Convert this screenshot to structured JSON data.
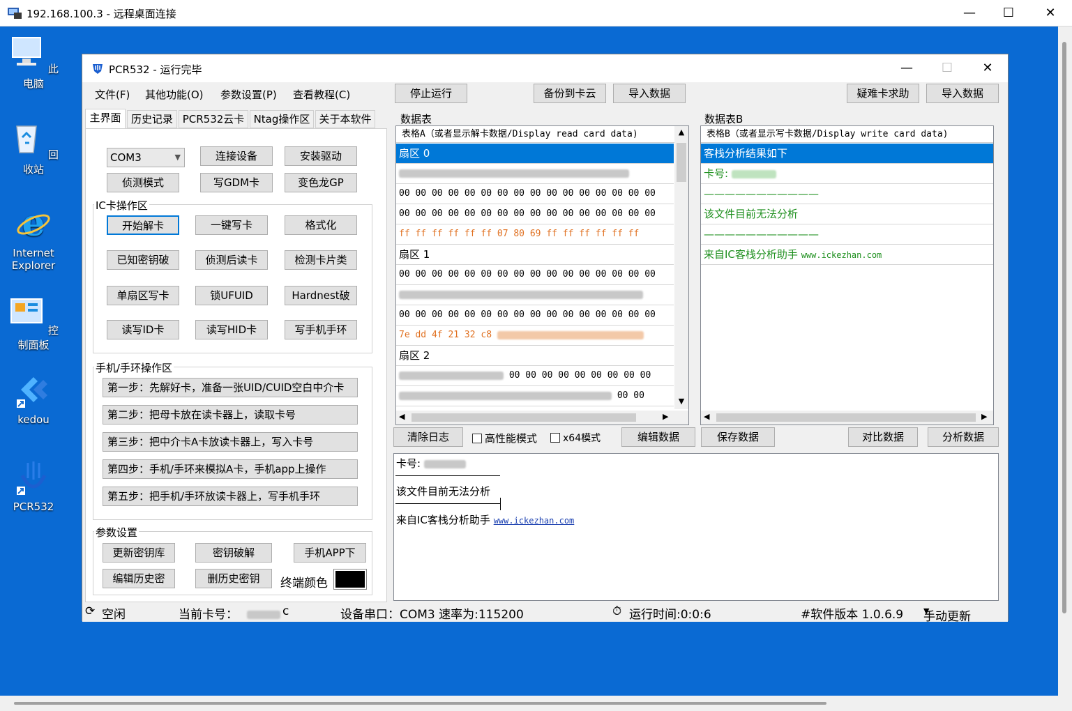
{
  "rdp": {
    "title": "192.168.100.3 - 远程桌面连接",
    "min": "—",
    "max": "☐",
    "close": "✕"
  },
  "desktop_icons": [
    {
      "label": "此电脑",
      "icon": "computer-icon"
    },
    {
      "label": "回收站",
      "icon": "recycle-bin-icon"
    },
    {
      "label": "Internet Explorer",
      "icon": "ie-icon"
    },
    {
      "label": "控制面板",
      "icon": "control-panel-icon"
    },
    {
      "label": "kedou",
      "icon": "kedou-icon"
    },
    {
      "label": "PCR532",
      "icon": "pcr532-icon"
    }
  ],
  "app": {
    "title": "PCR532 - 运行完毕",
    "min": "—",
    "max": "☐",
    "close": "✕"
  },
  "menu": [
    "文件(F)",
    "其他功能(O)",
    "参数设置(P)",
    "查看教程(C)"
  ],
  "toolbar": {
    "stop": "停止运行",
    "backup": "备份到卡云",
    "import_a": "导入数据",
    "help": "疑难卡求助",
    "import_b": "导入数据"
  },
  "tabs": [
    "主界面",
    "历史记录",
    "PCR532云卡",
    "Ntag操作区",
    "关于本软件"
  ],
  "main": {
    "com_value": "COM3",
    "connect": "连接设备",
    "driver": "安装驱动",
    "detect": "侦测模式",
    "write_gdm": "写GDM卡",
    "chameleon": "变色龙GP",
    "ic_group": "IC卡操作区",
    "ic_buttons": [
      "开始解卡",
      "一键写卡",
      "格式化",
      "已知密钥破",
      "侦测后读卡",
      "检测卡片类",
      "单扇区写卡",
      "锁UFUID",
      "Hardnest破",
      "读写ID卡",
      "读写HID卡",
      "写手机手环"
    ],
    "phone_group": "手机/手环操作区",
    "steps": [
      "第一步：先解好卡，准备一张UID/CUID空白中介卡",
      "第二步：把母卡放在读卡器上，读取卡号",
      "第三步：把中介卡A卡放读卡器上，写入卡号",
      "第四步：手机/手环来模拟A卡，手机app上操作",
      "第五步：把手机/手环放读卡器上，写手机手环"
    ],
    "param_group": "参数设置",
    "update_keys": "更新密钥库",
    "key_crack": "密钥破解",
    "phone_app": "手机APP下",
    "edit_history": "编辑历史密",
    "delete_history": "删历史密钥",
    "terminal_color_label": "终端颜色",
    "terminal_color": "#000000"
  },
  "table_a": {
    "caption": "数据表",
    "header": "表格A（或者显示解卡数据/Display read card data)",
    "sector0": "扇区 0",
    "zeros": "00 00 00 00 00 00 00 00 00 00 00 00 00 00 00 00",
    "trailer0": "ff ff ff ff ff ff 07 80 69 ff ff ff ff ff ff",
    "sector1": "扇区 1",
    "trailer1_prefix": "7e dd 4f 21 32 c8",
    "sector2": "扇区 2",
    "tail_partial": "00 00 00 00 00 00 00 00 00",
    "tail_short": "00 00"
  },
  "table_b": {
    "caption": "数据表B",
    "header": "表格B（或者显示写卡数据/Display write card data)",
    "result": "客栈分析结果如下",
    "card_label": "卡号:",
    "divider": "———————————",
    "cannot": "该文件目前无法分析",
    "source": "来自IC客栈分析助手",
    "url": "www.ickezhan.com"
  },
  "under": {
    "clear_log": "清除日志",
    "high_perf": "高性能模式",
    "x64": "x64模式",
    "edit_data": "编辑数据",
    "save_data": "保存数据",
    "compare": "对比数据",
    "analyze": "分析数据"
  },
  "log": {
    "card_label": "卡号:",
    "cannot": "该文件目前无法分析",
    "source": "来自IC客栈分析助手",
    "url": "www.ickezhan.com"
  },
  "status": {
    "idle": "空闲",
    "card_label": "当前卡号：",
    "card_suffix": "c",
    "port": "设备串口：COM3 速率为:115200",
    "runtime": "运行时间:0:0:6",
    "version": "#软件版本 1.0.6.9",
    "update": "手动更新"
  },
  "colors": {
    "desktop": "#0a6ad3",
    "selection": "#0078d7",
    "orange": "#e07020",
    "green": "#1d8f1d",
    "link": "#1a3fb0"
  }
}
